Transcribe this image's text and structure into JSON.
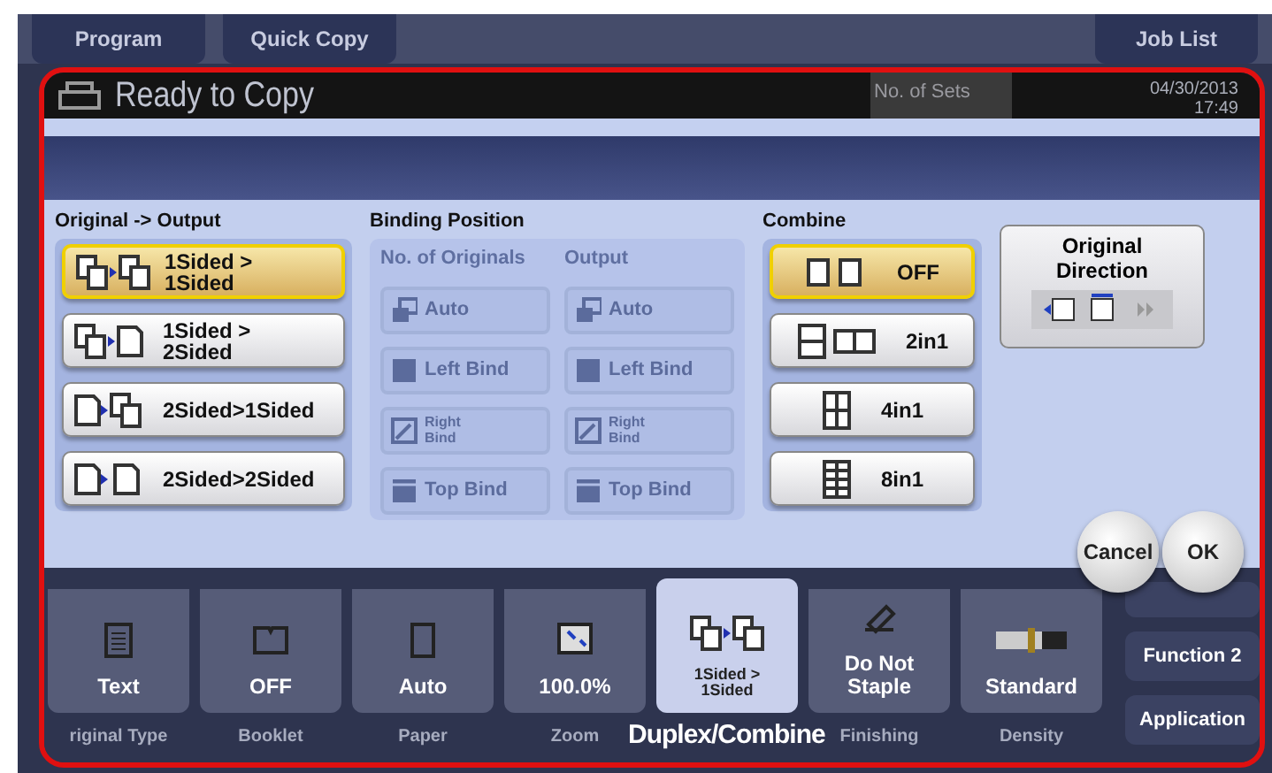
{
  "top_tabs": [
    {
      "label": "Program"
    },
    {
      "label": "Quick Copy"
    },
    {
      "label": "Job List"
    }
  ],
  "header": {
    "title": "Ready to Copy",
    "sets_label": "No. of Sets",
    "date": "04/30/2013",
    "time": "17:49"
  },
  "original_output": {
    "title": "Original -> Output",
    "options": [
      {
        "line1": "1Sided >",
        "line2": "1Sided",
        "kind": "simplex",
        "selected": true
      },
      {
        "line1": "1Sided >",
        "line2": "2Sided",
        "kind": "tofront",
        "selected": false
      },
      {
        "line1": "2Sided>1Sided",
        "kind": "split",
        "selected": false
      },
      {
        "line1": "2Sided>2Sided",
        "kind": "duplex",
        "selected": false
      }
    ]
  },
  "binding": {
    "title": "Binding Position",
    "disabled": true,
    "columns": [
      {
        "title": "No. of Originals",
        "options": [
          {
            "label": "Auto",
            "kind": "auto"
          },
          {
            "label": "Left Bind",
            "kind": "left"
          },
          {
            "label": "Right Bind",
            "kind": "right"
          },
          {
            "label": "Top Bind",
            "kind": "top"
          }
        ]
      },
      {
        "title": "Output",
        "options": [
          {
            "label": "Auto",
            "kind": "auto"
          },
          {
            "label": "Left Bind",
            "kind": "left"
          },
          {
            "label": "Right Bind",
            "kind": "right"
          },
          {
            "label": "Top Bind",
            "kind": "top"
          }
        ]
      }
    ]
  },
  "combine": {
    "title": "Combine",
    "options": [
      {
        "label": "OFF",
        "kind": "off",
        "selected": true
      },
      {
        "label": "2in1",
        "kind": "two",
        "selected": false
      },
      {
        "label": "4in1",
        "kind": "four",
        "selected": false
      },
      {
        "label": "8in1",
        "kind": "eight",
        "selected": false
      }
    ]
  },
  "original_direction": {
    "label": "Original Direction"
  },
  "function_tiles": [
    {
      "value": "Text",
      "label": "riginal Type",
      "kind": "text",
      "selected": false
    },
    {
      "value": "OFF",
      "label": "Booklet",
      "kind": "booklet",
      "selected": false
    },
    {
      "value": "Auto",
      "label": "Paper",
      "kind": "paper",
      "selected": false
    },
    {
      "value": "100.0%",
      "label": "Zoom",
      "kind": "zoom",
      "selected": false
    },
    {
      "value": "1Sided > 1Sided",
      "kind": "duplex",
      "selected": true
    },
    {
      "value": "Do Not Staple",
      "label": "Finishing",
      "kind": "finishing",
      "selected": false
    },
    {
      "value": "Standard",
      "label": "Density",
      "kind": "density",
      "selected": false
    }
  ],
  "popup_label": "Duplex/Combine",
  "dialog_buttons": [
    "Cancel",
    "OK"
  ],
  "side_buttons": [
    "Function 2",
    "Application"
  ]
}
